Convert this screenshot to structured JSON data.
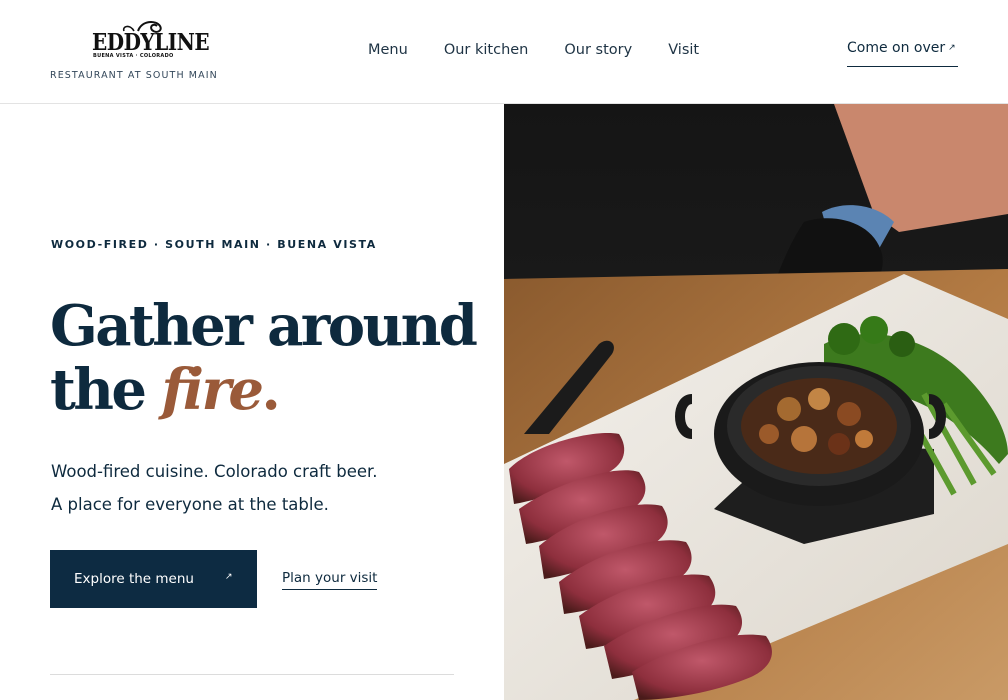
{
  "brand": {
    "name": "EDDYLINE",
    "subline": "BUENA VISTA · COLORADO",
    "tagline": "RESTAURANT AT SOUTH MAIN"
  },
  "nav": {
    "items": [
      {
        "label": "Menu"
      },
      {
        "label": "Our kitchen"
      },
      {
        "label": "Our story"
      },
      {
        "label": "Visit"
      }
    ],
    "cta_label": "Come on over",
    "cta_icon": "arrow-up-right-icon"
  },
  "hero": {
    "eyebrow": "WOOD-FIRED · SOUTH MAIN · BUENA VISTA",
    "headline_line1": "Gather around",
    "headline_line2_start": "the ",
    "headline_accent": "fire",
    "headline_end": ".",
    "lede_line1": "Wood-fired cuisine. Colorado craft beer.",
    "lede_line2": "A place for everyone at the table.",
    "primary_button": "Explore the menu",
    "secondary_link": "Plan your visit"
  },
  "colors": {
    "navy": "#0d2b42",
    "accent": "#9a5a39",
    "divider": "#dcdcdc"
  }
}
